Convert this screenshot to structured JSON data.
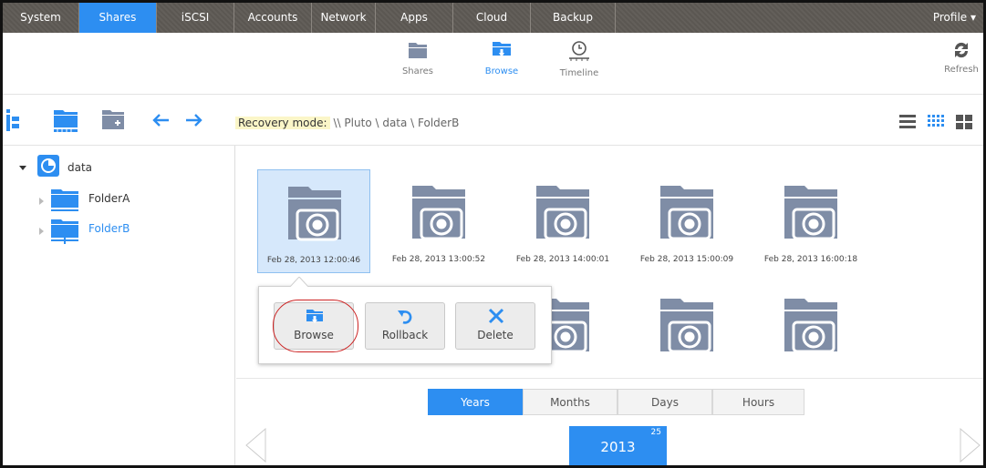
{
  "nav": {
    "tabs": [
      "System",
      "Shares",
      "iSCSI",
      "Accounts",
      "Network",
      "Apps",
      "Cloud",
      "Backup"
    ],
    "active_tab": "Shares",
    "profile": "Profile ▾"
  },
  "subbar": {
    "shares": "Shares",
    "browse": "Browse",
    "timeline": "Timeline",
    "refresh": "Refresh"
  },
  "pathbar": {
    "mode_label": "Recovery mode:",
    "path": "\\\\ Pluto \\ data \\ FolderB"
  },
  "tree": {
    "root": "data",
    "items": [
      "FolderA",
      "FolderB"
    ],
    "selected": "FolderB"
  },
  "snapshots": [
    "Feb 28, 2013 12:00:46",
    "Feb 28, 2013 13:00:52",
    "Feb 28, 2013 14:00:01",
    "Feb 28, 2013 15:00:09",
    "Feb 28, 2013 16:00:18"
  ],
  "popup": {
    "browse": "Browse",
    "rollback": "Rollback",
    "delete": "Delete"
  },
  "timeline": {
    "segments": [
      "Years",
      "Months",
      "Days",
      "Hours"
    ],
    "active": "Years",
    "year": "2013",
    "count": "25"
  },
  "colors": {
    "accent": "#2d8ef1",
    "nav_bg": "#5e5a55",
    "icon_gray": "#7f8da6",
    "highlight_yellow": "#fbf6c8"
  }
}
